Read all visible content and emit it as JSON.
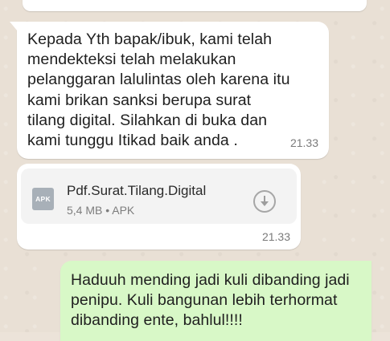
{
  "messages": {
    "incoming_text": {
      "text": "Kepada Yth bapak/ibuk, kami telah mendekteksi telah melakukan pelanggaran lalulintas oleh karena itu kami brikan sanksi berupa surat tilang digital. Silahkan di buka dan kami tunggu Itikad baik anda .",
      "time": "21.33"
    },
    "incoming_document": {
      "file_type_label": "APK",
      "file_name": "Pdf.Surat.Tilang.Digital",
      "file_meta": "5,4 MB • APK",
      "time": "21.33",
      "download_icon": "download-arrow-icon"
    },
    "outgoing_text": {
      "text": "Haduuh mending jadi kuli dibanding jadi penipu. Kuli bangunan lebih terhormat dibanding ente, bahlul!!!!"
    }
  },
  "colors": {
    "chat_background": "#e9e0d5",
    "incoming_bubble": "#ffffff",
    "outgoing_bubble": "#d8f8c7",
    "document_box": "#f3f3f3"
  }
}
